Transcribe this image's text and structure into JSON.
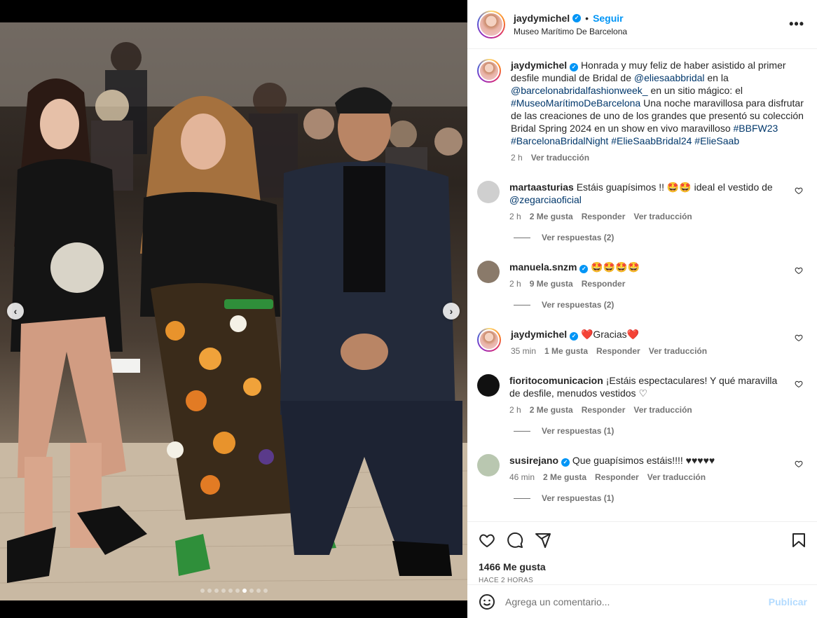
{
  "post": {
    "username": "jaydymichel",
    "follow_label": "Seguir",
    "separator": "•",
    "location": "Museo Marítimo De Barcelona",
    "more_label": "•••",
    "verified_mark": "✓",
    "carousel": {
      "total": 10,
      "active_index": 6
    }
  },
  "caption": {
    "username": "jaydymichel",
    "t1": "Honrada y muy feliz de haber asistido al primer desfile mundial de Bridal de ",
    "m1": "@eliesaabbridal",
    "t2": " en la ",
    "m2": "@barcelonabridalfashionweek_",
    "t3": " en un sitio mágico: el ",
    "m3": "#MuseoMarítimoDeBarcelona",
    "t4": " Una noche maravillosa para disfrutar de las creaciones de uno de los grandes que presentó su colección Bridal Spring 2024 en un show en vivo maravilloso ",
    "m4": "#BBFW23",
    "m5": "#BarcelonaBridalNight",
    "m6": "#ElieSaabBridal24",
    "m7": "#ElieSaab",
    "time": "2 h",
    "translate": "Ver traducción"
  },
  "comments": [
    {
      "username": "martaasturias",
      "text": "Estáis guapísimos !! 🤩🤩 ideal el vestido de ",
      "mention": "@zegarciaoficial",
      "time": "2 h",
      "likes": "2 Me gusta",
      "reply": "Responder",
      "translate": "Ver traducción",
      "replies": "Ver respuestas (2)",
      "avatar_color": "#cfcfcf"
    },
    {
      "username": "manuela.snzm",
      "text": "🤩🤩🤩🤩",
      "time": "2 h",
      "likes": "9 Me gusta",
      "reply": "Responder",
      "replies": "Ver respuestas (2)",
      "avatar_color": "#8a7a6a"
    },
    {
      "username": "jaydymichel",
      "text": "❤️Gracias❤️",
      "time": "35 min",
      "likes": "1 Me gusta",
      "reply": "Responder",
      "translate": "Ver traducción"
    },
    {
      "username": "fioritocomunicacion",
      "text": "¡Estáis espectaculares! Y qué maravilla de desfile, menudos vestidos ♡",
      "time": "2 h",
      "likes": "2 Me gusta",
      "reply": "Responder",
      "translate": "Ver traducción",
      "replies": "Ver respuestas (1)",
      "avatar_color": "#111111"
    },
    {
      "username": "susirejano",
      "text": "Que guapísimos estáis!!!! ♥♥♥♥♥",
      "time": "46 min",
      "likes": "2 Me gusta",
      "reply": "Responder",
      "translate": "Ver traducción",
      "replies": "Ver respuestas (1)",
      "avatar_color": "#b9c7b0"
    }
  ],
  "footer": {
    "likes": "1466 Me gusta",
    "time": "HACE 2 HORAS",
    "comment_placeholder": "Agrega un comentario...",
    "publish": "Publicar"
  },
  "colors": {
    "accent": "#0095f6",
    "link": "#00376b",
    "muted": "#737373",
    "text": "#262626"
  }
}
